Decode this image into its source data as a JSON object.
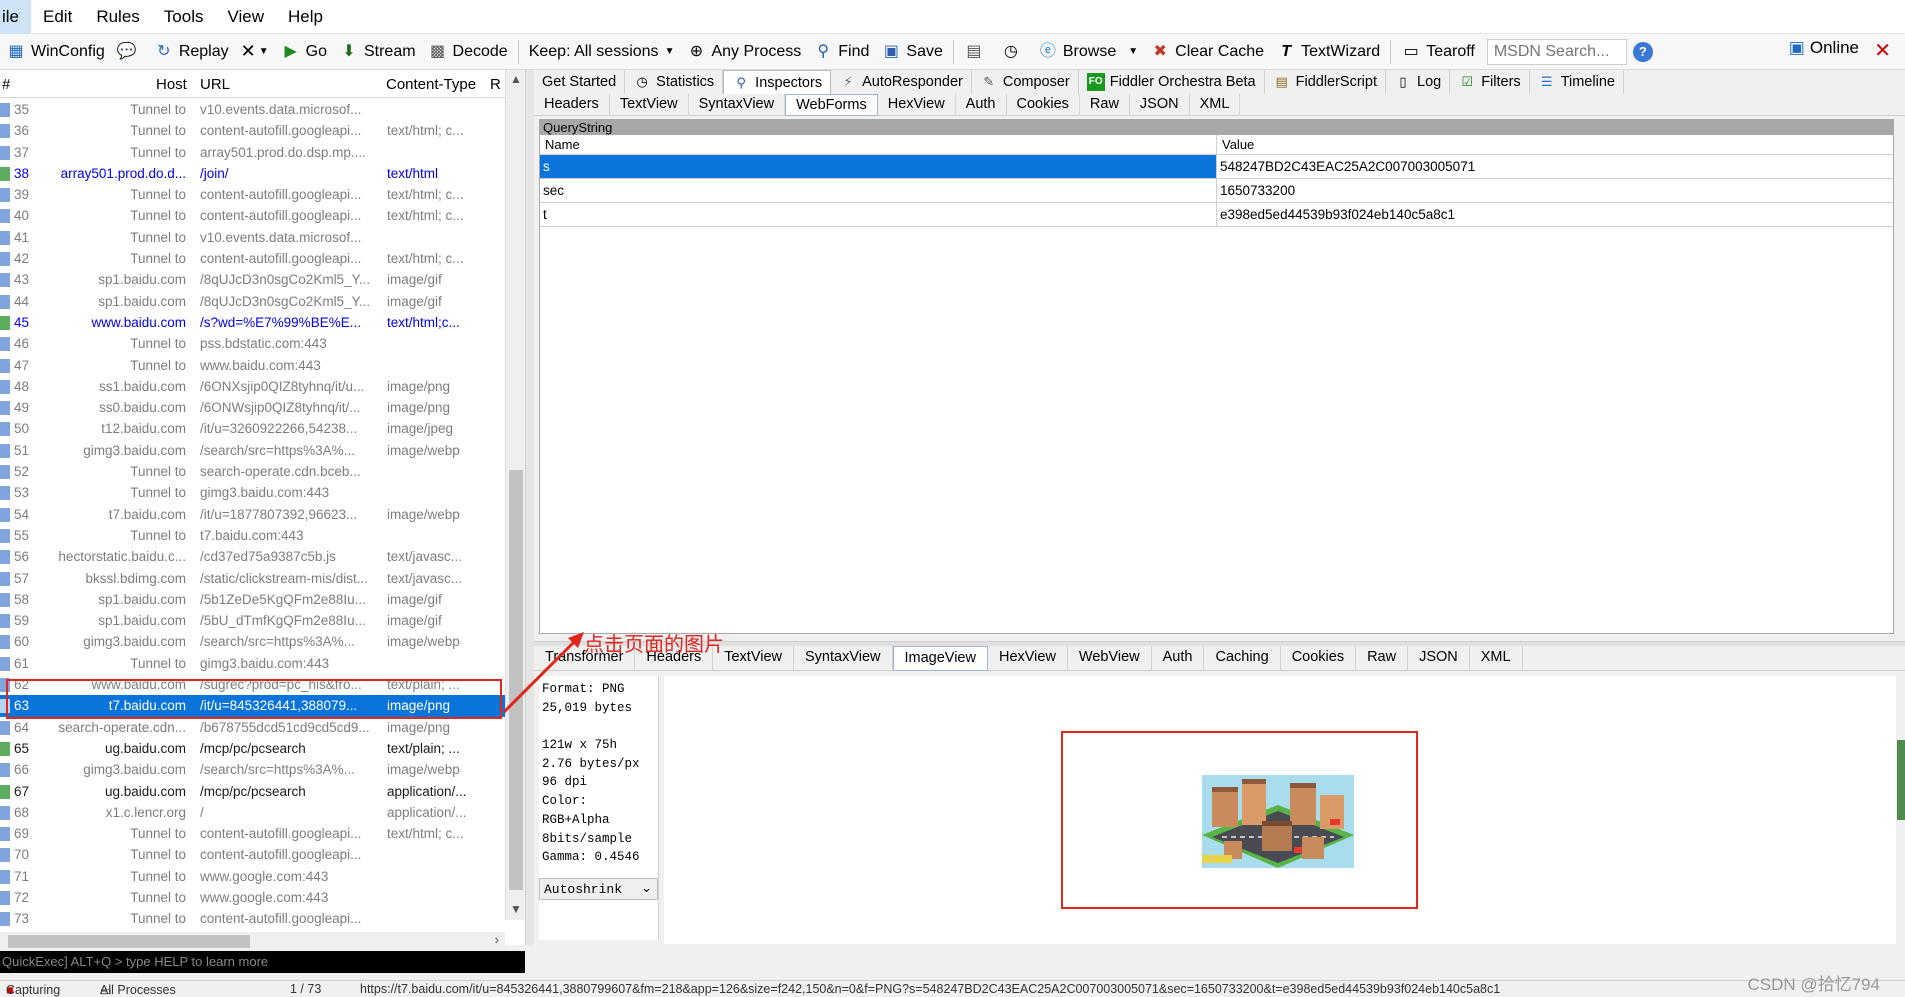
{
  "menu": [
    "ile",
    "Edit",
    "Rules",
    "Tools",
    "View",
    "Help"
  ],
  "toolbar": {
    "winconfig": "WinConfig",
    "replay": "Replay",
    "go": "Go",
    "stream": "Stream",
    "decode": "Decode",
    "keep": "Keep: All sessions",
    "any_process": "Any Process",
    "find": "Find",
    "save": "Save",
    "browse": "Browse",
    "clear_cache": "Clear Cache",
    "textwizard": "TextWizard",
    "tearoff": "Tearoff",
    "msdn_placeholder": "MSDN Search...",
    "online": "Online"
  },
  "sessions": {
    "headers": {
      "num": "#",
      "host": "Host",
      "url": "URL",
      "ct": "Content-Type",
      "rc": "R"
    },
    "rows": [
      {
        "num": "35",
        "host": "Tunnel to",
        "url": "v10.events.data.microsof...",
        "ct": "",
        "style": "grey"
      },
      {
        "num": "36",
        "host": "Tunnel to",
        "url": "content-autofill.googleapi...",
        "ct": "text/html; c...",
        "style": "grey"
      },
      {
        "num": "37",
        "host": "Tunnel to",
        "url": "array501.prod.do.dsp.mp....",
        "ct": "",
        "style": "grey"
      },
      {
        "num": "38",
        "host": "array501.prod.do.d...",
        "url": "/join/",
        "ct": "text/html",
        "style": "blue"
      },
      {
        "num": "39",
        "host": "Tunnel to",
        "url": "content-autofill.googleapi...",
        "ct": "text/html; c...",
        "style": "grey"
      },
      {
        "num": "40",
        "host": "Tunnel to",
        "url": "content-autofill.googleapi...",
        "ct": "text/html; c...",
        "style": "grey"
      },
      {
        "num": "41",
        "host": "Tunnel to",
        "url": "v10.events.data.microsof...",
        "ct": "",
        "style": "grey"
      },
      {
        "num": "42",
        "host": "Tunnel to",
        "url": "content-autofill.googleapi...",
        "ct": "text/html; c...",
        "style": "grey"
      },
      {
        "num": "43",
        "host": "sp1.baidu.com",
        "url": "/8qUJcD3n0sgCo2Kml5_Y...",
        "ct": "image/gif",
        "style": "grey"
      },
      {
        "num": "44",
        "host": "sp1.baidu.com",
        "url": "/8qUJcD3n0sgCo2Kml5_Y...",
        "ct": "image/gif",
        "style": "grey"
      },
      {
        "num": "45",
        "host": "www.baidu.com",
        "url": "/s?wd=%E7%99%BE%E...",
        "ct": "text/html;c...",
        "style": "blue"
      },
      {
        "num": "46",
        "host": "Tunnel to",
        "url": "pss.bdstatic.com:443",
        "ct": "",
        "style": "grey"
      },
      {
        "num": "47",
        "host": "Tunnel to",
        "url": "www.baidu.com:443",
        "ct": "",
        "style": "grey"
      },
      {
        "num": "48",
        "host": "ss1.baidu.com",
        "url": "/6ONXsjip0QIZ8tyhnq/it/u...",
        "ct": "image/png",
        "style": "grey"
      },
      {
        "num": "49",
        "host": "ss0.baidu.com",
        "url": "/6ONWsjip0QIZ8tyhnq/it/...",
        "ct": "image/png",
        "style": "grey"
      },
      {
        "num": "50",
        "host": "t12.baidu.com",
        "url": "/it/u=3260922266,54238...",
        "ct": "image/jpeg",
        "style": "grey"
      },
      {
        "num": "51",
        "host": "gimg3.baidu.com",
        "url": "/search/src=https%3A%...",
        "ct": "image/webp",
        "style": "grey"
      },
      {
        "num": "52",
        "host": "Tunnel to",
        "url": "search-operate.cdn.bceb...",
        "ct": "",
        "style": "grey"
      },
      {
        "num": "53",
        "host": "Tunnel to",
        "url": "gimg3.baidu.com:443",
        "ct": "",
        "style": "grey"
      },
      {
        "num": "54",
        "host": "t7.baidu.com",
        "url": "/it/u=1877807392,96623...",
        "ct": "image/webp",
        "style": "grey"
      },
      {
        "num": "55",
        "host": "Tunnel to",
        "url": "t7.baidu.com:443",
        "ct": "",
        "style": "grey"
      },
      {
        "num": "56",
        "host": "hectorstatic.baidu.c...",
        "url": "/cd37ed75a9387c5b.js",
        "ct": "text/javasc...",
        "style": "grey"
      },
      {
        "num": "57",
        "host": "bkssl.bdimg.com",
        "url": "/static/clickstream-mis/dist...",
        "ct": "text/javasc...",
        "style": "grey"
      },
      {
        "num": "58",
        "host": "sp1.baidu.com",
        "url": "/5b1ZeDe5KgQFm2e88Iu...",
        "ct": "image/gif",
        "style": "grey"
      },
      {
        "num": "59",
        "host": "sp1.baidu.com",
        "url": "/5bU_dTmfKgQFm2e88Iu...",
        "ct": "image/gif",
        "style": "grey"
      },
      {
        "num": "60",
        "host": "gimg3.baidu.com",
        "url": "/search/src=https%3A%...",
        "ct": "image/webp",
        "style": "grey"
      },
      {
        "num": "61",
        "host": "Tunnel to",
        "url": "gimg3.baidu.com:443",
        "ct": "",
        "style": "grey"
      },
      {
        "num": "62",
        "host": "www.baidu.com",
        "url": "/sugrec?prod=pc_his&fro...",
        "ct": "text/plain; ...",
        "style": "grey"
      },
      {
        "num": "63",
        "host": "t7.baidu.com",
        "url": "/it/u=845326441,388079...",
        "ct": "image/png",
        "style": "sel"
      },
      {
        "num": "64",
        "host": "search-operate.cdn...",
        "url": "/b678755dcd51cd9cd5cd9...",
        "ct": "image/png",
        "style": "grey"
      },
      {
        "num": "65",
        "host": "ug.baidu.com",
        "url": "/mcp/pc/pcsearch",
        "ct": "text/plain; ...",
        "style": "black"
      },
      {
        "num": "66",
        "host": "gimg3.baidu.com",
        "url": "/search/src=https%3A%...",
        "ct": "image/webp",
        "style": "grey"
      },
      {
        "num": "67",
        "host": "ug.baidu.com",
        "url": "/mcp/pc/pcsearch",
        "ct": "application/...",
        "style": "black"
      },
      {
        "num": "68",
        "host": "x1.c.lencr.org",
        "url": "/",
        "ct": "application/...",
        "style": "grey"
      },
      {
        "num": "69",
        "host": "Tunnel to",
        "url": "content-autofill.googleapi...",
        "ct": "text/html; c...",
        "style": "grey"
      },
      {
        "num": "70",
        "host": "Tunnel to",
        "url": "content-autofill.googleapi...",
        "ct": "",
        "style": "grey"
      },
      {
        "num": "71",
        "host": "Tunnel to",
        "url": "www.google.com:443",
        "ct": "",
        "style": "grey"
      },
      {
        "num": "72",
        "host": "Tunnel to",
        "url": "www.google.com:443",
        "ct": "",
        "style": "grey"
      },
      {
        "num": "73",
        "host": "Tunnel to",
        "url": "content-autofill.googleapi...",
        "ct": "",
        "style": "grey"
      }
    ]
  },
  "quickexec": "QuickExec] ALT+Q > type HELP to learn more",
  "inspector_tabs": [
    "Get Started",
    "Statistics",
    "Inspectors",
    "AutoResponder",
    "Composer",
    "Fiddler Orchestra Beta",
    "FiddlerScript",
    "Log",
    "Filters",
    "Timeline"
  ],
  "request_tabs": [
    "Headers",
    "TextView",
    "SyntaxView",
    "WebForms",
    "HexView",
    "Auth",
    "Cookies",
    "Raw",
    "JSON",
    "XML"
  ],
  "querystring": {
    "title": "QueryString",
    "col_name": "Name",
    "col_value": "Value",
    "rows": [
      {
        "name": "s",
        "value": "548247BD2C43EAC25A2C007003005071"
      },
      {
        "name": "sec",
        "value": "1650733200"
      },
      {
        "name": "t",
        "value": "e398ed5ed44539b93f024eb140c5a8c1"
      }
    ]
  },
  "response_tabs": [
    "Transformer",
    "Headers",
    "TextView",
    "SyntaxView",
    "ImageView",
    "HexView",
    "WebView",
    "Auth",
    "Caching",
    "Cookies",
    "Raw",
    "JSON",
    "XML"
  ],
  "image_info": [
    "Format: PNG",
    "25,019 bytes",
    "",
    "121w x 75h",
    "2.76 bytes/px",
    "96 dpi",
    "Color:",
    "RGB+Alpha",
    "8bits/sample",
    "Gamma: 0.4546"
  ],
  "autoshrink": "Autoshrink",
  "annotation": "点击页面的图片",
  "status": {
    "capturing": "Capturing",
    "processes": "All Processes",
    "count": "1 / 73",
    "url": "https://t7.baidu.com/it/u=845326441,3880799607&fm=218&app=126&size=f242,150&n=0&f=PNG?s=548247BD2C43EAC25A2C007003005071&sec=1650733200&t=e398ed5ed44539b93f024eb140c5a8c1"
  },
  "watermark": "CSDN @拾忆794",
  "colors": {
    "selection": "#0a74da",
    "annotation": "#e0261d",
    "link": "#0000ee"
  }
}
